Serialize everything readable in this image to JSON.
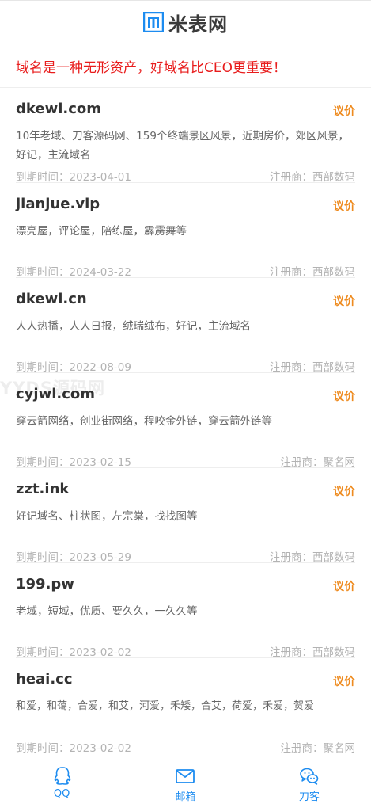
{
  "header": {
    "logo_text": "米表网",
    "logo_icon": "logo-icon"
  },
  "banner": {
    "text": "域名是一种无形资产，好域名比CEO更重要！"
  },
  "list": {
    "items": [
      {
        "domain": "dkewl.com",
        "action": "议价",
        "desc": "10年老域、刀客源码网、159个终端景区风景，近期房价，郊区风景，好记，主流域名",
        "expiry": "到期时间：2023-04-01",
        "registrar": "注册商：西部数码"
      },
      {
        "domain": "jianjue.vip",
        "action": "议价",
        "desc": "漂亮屋，评论屋，陪练屋，霹雳舞等",
        "expiry": "到期时间：2024-03-22",
        "registrar": "注册商：西部数码"
      },
      {
        "domain": "dkewl.cn",
        "action": "议价",
        "desc": "人人热播，人人日报，绒瑞绒布，好记，主流域名",
        "expiry": "到期时间：2022-08-09",
        "registrar": "注册商：西部数码"
      },
      {
        "domain": "cyjwl.com",
        "action": "议价",
        "desc": "穿云箭网络，创业街网络，程咬金外链，穿云箭外链等",
        "expiry": "到期时间：2023-02-15",
        "registrar": "注册商：聚名网"
      },
      {
        "domain": "zzt.ink",
        "action": "议价",
        "desc": "好记域名、柱状图，左宗棠，找找图等",
        "expiry": "到期时间：2023-05-29",
        "registrar": "注册商：西部数码"
      },
      {
        "domain": "199.pw",
        "action": "议价",
        "desc": "老域，短域，优质、要久久，一久久等",
        "expiry": "到期时间：2023-02-02",
        "registrar": "注册商：西部数码"
      },
      {
        "domain": "heai.cc",
        "action": "议价",
        "desc": "和爱，和蔼，合爱，和艾，河爱，禾矮，合艾，荷爱，禾爱，贺爱",
        "expiry": "到期时间：2023-02-02",
        "registrar": "注册商：聚名网"
      }
    ]
  },
  "watermark": "YYDS源码网",
  "tabbar": {
    "tabs": [
      {
        "label": "QQ",
        "icon": "qq-icon"
      },
      {
        "label": "邮箱",
        "icon": "mail-icon"
      },
      {
        "label": "刀客",
        "icon": "wechat-icon"
      }
    ],
    "color": "#1d8cf0"
  },
  "colors": {
    "accent": "#ee8a1e",
    "banner": "#e81c1c",
    "logo": "#1d8cf0"
  }
}
